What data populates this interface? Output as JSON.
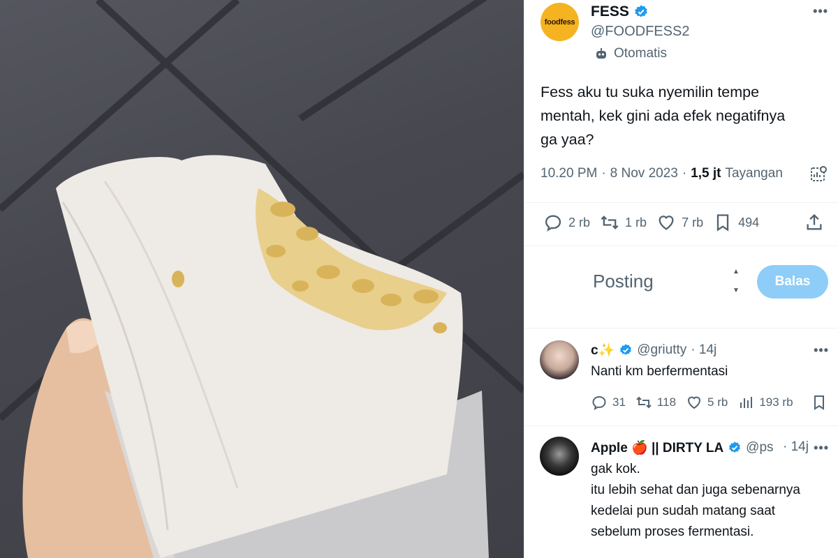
{
  "colors": {
    "accent": "#1d9bf0",
    "reply_button": "#8ecdf8",
    "muted": "#536471",
    "text": "#0f1419"
  },
  "photo": {
    "alt": ""
  },
  "tweet": {
    "avatar_text": "foodfess",
    "name": "FESS",
    "handle": "@FOODFESS2",
    "automated_label": "Otomatis",
    "text": "Fess aku tu suka nyemilin tempe\nmentah, kek gini ada efek negatifnya\nga yaa?",
    "time": "10.20 PM",
    "date": "8 Nov 2023",
    "views_count": "1,5 jt",
    "views_label": "Tayangan",
    "stats": {
      "replies": "2 rb",
      "retweets": "1 rb",
      "likes": "7 rb",
      "bookmarks": "494"
    },
    "icons": [
      "verified-icon",
      "bot-icon",
      "reply-icon",
      "retweet-icon",
      "like-icon",
      "bookmark-icon",
      "share-icon",
      "analytics-icon",
      "more-icon"
    ]
  },
  "composer": {
    "placeholder": "Posting",
    "reply_button": "Balas"
  },
  "replies": [
    {
      "name": "c✨",
      "handle": "@griutty",
      "age": "· 14j",
      "text": "Nanti km berfermentasi",
      "stats": {
        "replies": "31",
        "retweets": "118",
        "likes": "5 rb",
        "views": "193 rb"
      }
    },
    {
      "name": "Apple 🍎 || DIRTY LA",
      "handle": "@ps",
      "age": "· 14j",
      "text": "gak kok.\nitu lebih sehat dan juga sebenarnya\nkedelai pun sudah matang saat\nsebelum proses fermentasi."
    }
  ]
}
